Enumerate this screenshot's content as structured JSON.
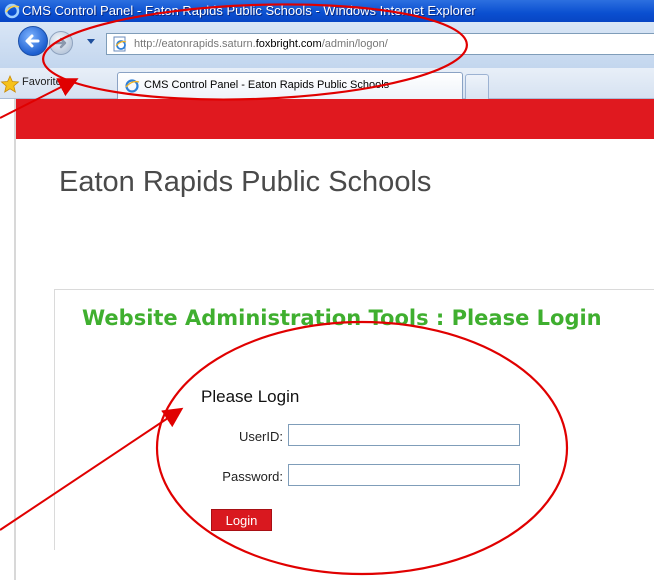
{
  "window": {
    "title": "CMS Control Panel - Eaton Rapids Public Schools - Windows Internet Explorer"
  },
  "address_bar": {
    "url_prefix": "http://eatonrapids.saturn.",
    "url_domain": "foxbright.com",
    "url_path": "/admin/logon/"
  },
  "toolbar": {
    "favorites_label": "Favorites",
    "active_tab_label": "CMS Control Panel - Eaton Rapids Public Schools"
  },
  "page": {
    "site_title": "Eaton Rapids Public Schools",
    "admin_heading": "Website Administration Tools : Please Login",
    "login_heading": "Please Login",
    "userid_label": "UserID:",
    "password_label": "Password:",
    "userid_value": "",
    "password_value": "",
    "login_button": "Login"
  },
  "colors": {
    "brand_red": "#e0191f",
    "heading_green": "#3faf2f",
    "annotation_red": "#e00000"
  },
  "icons": [
    "ie-logo-icon",
    "back-arrow-icon",
    "forward-arrow-icon",
    "chevron-down-icon",
    "page-icon",
    "favorites-star-icon",
    "tab-ie-icon"
  ]
}
